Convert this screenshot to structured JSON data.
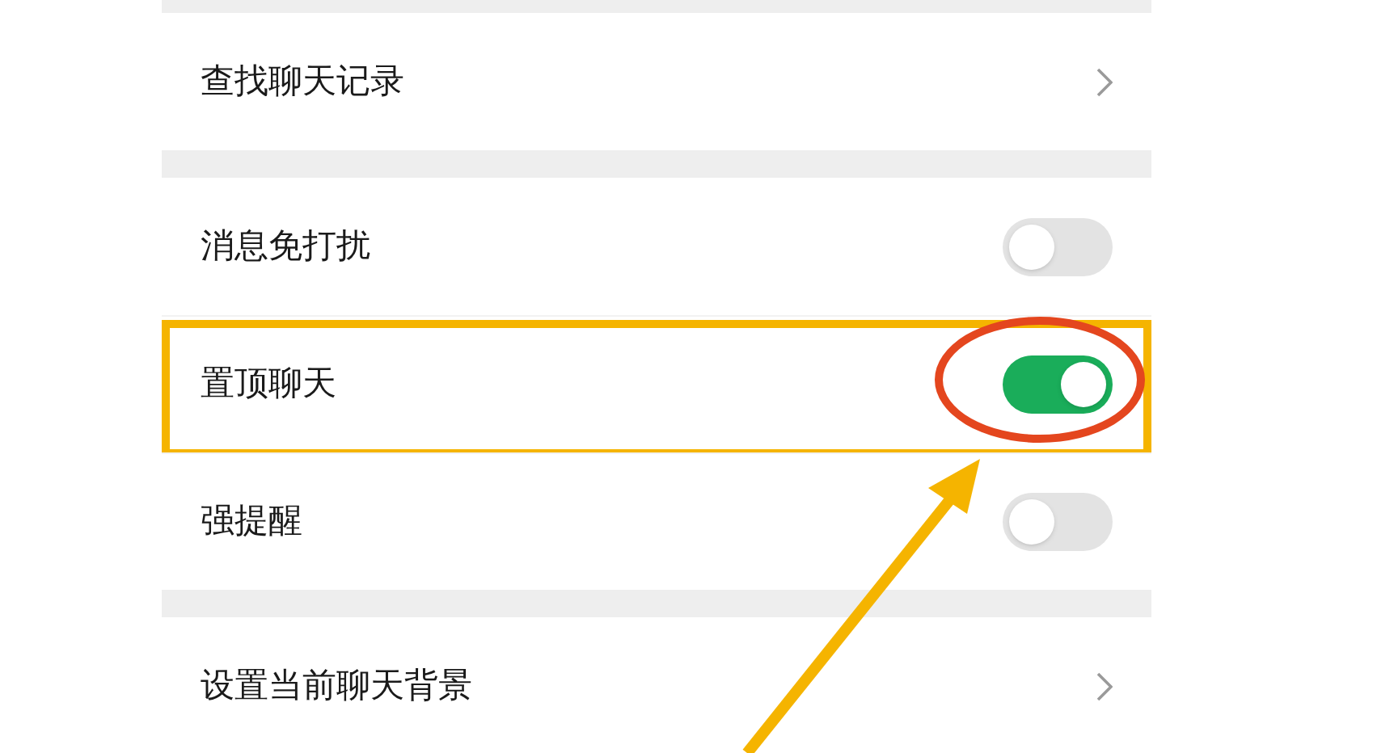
{
  "sections": [
    {
      "rows": [
        {
          "kind": "link",
          "label": "查找聊天记录"
        }
      ]
    },
    {
      "rows": [
        {
          "kind": "toggle",
          "label": "消息免打扰",
          "on": false,
          "highlighted": false
        },
        {
          "kind": "toggle",
          "label": "置顶聊天",
          "on": true,
          "highlighted": true
        },
        {
          "kind": "toggle",
          "label": "强提醒",
          "on": false,
          "highlighted": false
        }
      ]
    },
    {
      "rows": [
        {
          "kind": "link",
          "label": "设置当前聊天背景"
        }
      ]
    }
  ]
}
